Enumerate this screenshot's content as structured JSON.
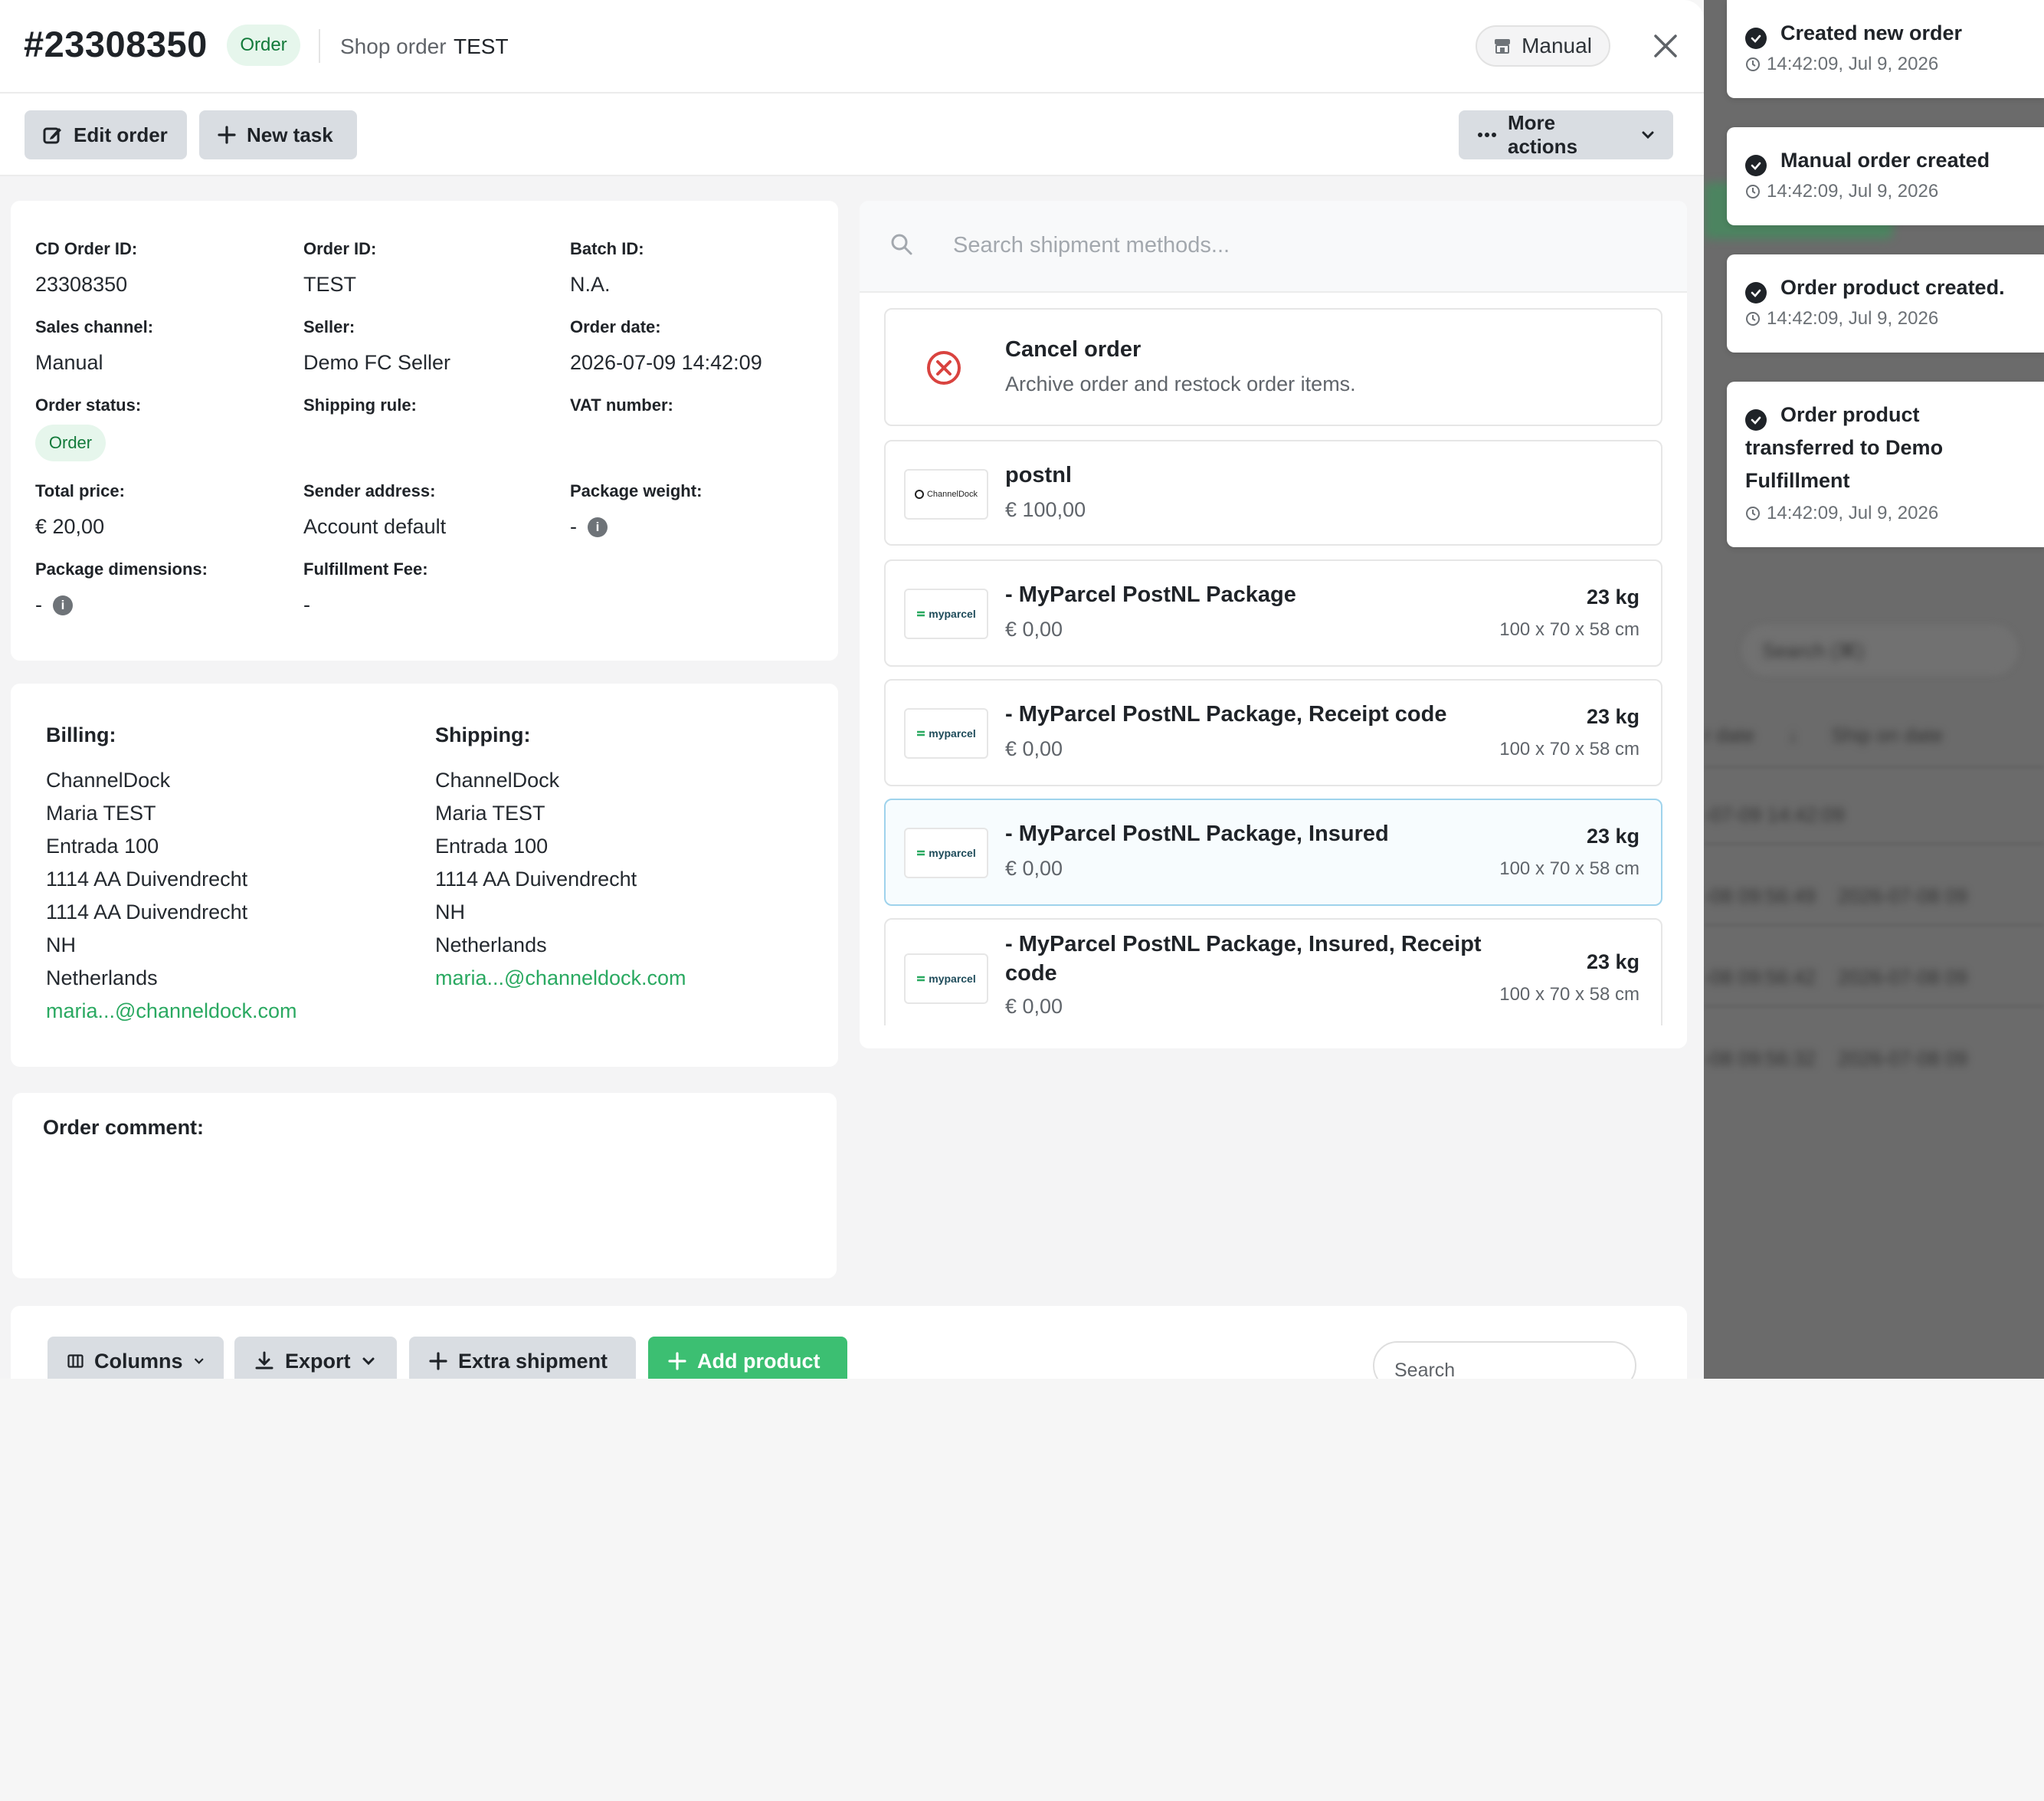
{
  "header": {
    "order_number": "#23308350",
    "status": "Order",
    "shop_order_label": "Shop order",
    "shop_order_value": "TEST",
    "channel": "Manual"
  },
  "toolbar": {
    "edit_order": "Edit order",
    "new_task": "New task",
    "more_actions": "More actions"
  },
  "info": {
    "cd_order_id": {
      "label": "CD Order ID:",
      "value": "23308350"
    },
    "order_id": {
      "label": "Order ID:",
      "value": "TEST"
    },
    "batch_id": {
      "label": "Batch ID:",
      "value": "N.A."
    },
    "sales_channel": {
      "label": "Sales channel:",
      "value": "Manual"
    },
    "seller": {
      "label": "Seller:",
      "value": "Demo FC Seller"
    },
    "order_date": {
      "label": "Order date:",
      "value": "2026-07-09 14:42:09"
    },
    "order_status": {
      "label": "Order status:",
      "value": "Order"
    },
    "shipping_rule": {
      "label": "Shipping rule:",
      "value": ""
    },
    "vat_number": {
      "label": "VAT number:",
      "value": ""
    },
    "total_price": {
      "label": "Total price:",
      "value": "€ 20,00"
    },
    "sender_address": {
      "label": "Sender address:",
      "value": "Account default"
    },
    "package_weight": {
      "label": "Package weight:",
      "value": "-"
    },
    "package_dimensions": {
      "label": "Package dimensions:",
      "value": "-"
    },
    "fulfillment_fee": {
      "label": "Fulfillment Fee:",
      "value": "-"
    }
  },
  "billing": {
    "heading": "Billing:",
    "lines": [
      "ChannelDock",
      "Maria TEST",
      "Entrada 100",
      "1114 AA Duivendrecht",
      "1114 AA Duivendrecht",
      "NH",
      "Netherlands"
    ],
    "email": "maria...@channeldock.com"
  },
  "shipping": {
    "heading": "Shipping:",
    "lines": [
      "ChannelDock",
      "Maria TEST",
      "Entrada 100",
      "1114 AA Duivendrecht",
      "NH",
      "Netherlands"
    ],
    "email": "maria...@channeldock.com"
  },
  "comment": {
    "heading": "Order comment:"
  },
  "shipment": {
    "search_placeholder": "Search shipment methods...",
    "cancel": {
      "title": "Cancel order",
      "subtitle": "Archive order and restock order items."
    },
    "methods": [
      {
        "logo": "ChannelDock",
        "name": "postnl",
        "price": "€ 100,00"
      },
      {
        "logo": "myparcel",
        "name": "- MyParcel PostNL Package",
        "price": "€ 0,00",
        "weight": "23 kg",
        "dims": "100 x 70 x 58 cm"
      },
      {
        "logo": "myparcel",
        "name": "- MyParcel PostNL Package, Receipt code",
        "price": "€ 0,00",
        "weight": "23 kg",
        "dims": "100 x 70 x 58 cm"
      },
      {
        "logo": "myparcel",
        "name": "- MyParcel PostNL Package, Insured",
        "price": "€ 0,00",
        "weight": "23 kg",
        "dims": "100 x 70 x 58 cm"
      },
      {
        "logo": "myparcel",
        "name_line1": "- MyParcel PostNL Package, Insured, Receipt",
        "name_line2": "code",
        "price": "€ 0,00",
        "weight": "23 kg",
        "dims": "100 x 70 x 58 cm"
      }
    ]
  },
  "table_toolbar": {
    "columns": "Columns",
    "export": "Export",
    "extra_shipment": "Extra shipment",
    "add_product": "Add product",
    "search_placeholder": "Search"
  },
  "notifications": [
    {
      "title": "Created new order",
      "time": "14:42:09, Jul 9, 2026"
    },
    {
      "title": "Manual order created",
      "time": "14:42:09, Jul 9, 2026"
    },
    {
      "title": "Order product created.",
      "time": "14:42:09, Jul 9, 2026"
    },
    {
      "title_lines": [
        "Order product",
        "transferred to Demo",
        "Fulfillment"
      ],
      "time": "14:42:09, Jul 9, 2026"
    }
  ],
  "colors": {
    "accent_green": "#3cbf72",
    "link_green": "#2aa961",
    "danger_red": "#d9433f",
    "overlay": "#6b6b6b"
  }
}
